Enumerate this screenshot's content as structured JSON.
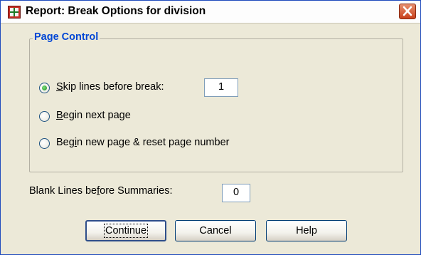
{
  "window": {
    "title": "Report: Break Options for division"
  },
  "page_control": {
    "legend": "Page Control",
    "options": [
      {
        "before": "",
        "mnemonic": "S",
        "after": "kip lines before break:",
        "checked": true
      },
      {
        "before": "",
        "mnemonic": "B",
        "after": "egin next page",
        "checked": false
      },
      {
        "before": "Beg",
        "mnemonic": "i",
        "after": "n new page & reset page number",
        "checked": false
      }
    ],
    "skip_lines_value": "1"
  },
  "summaries": {
    "label_before": "Blank Lines be",
    "label_mnemonic": "f",
    "label_after": "ore Summaries:",
    "value": "0"
  },
  "buttons": {
    "continue": "Continue",
    "cancel": "Cancel",
    "help": "Help"
  },
  "icons": {
    "app": "report-grid-icon",
    "close": "close-icon"
  }
}
